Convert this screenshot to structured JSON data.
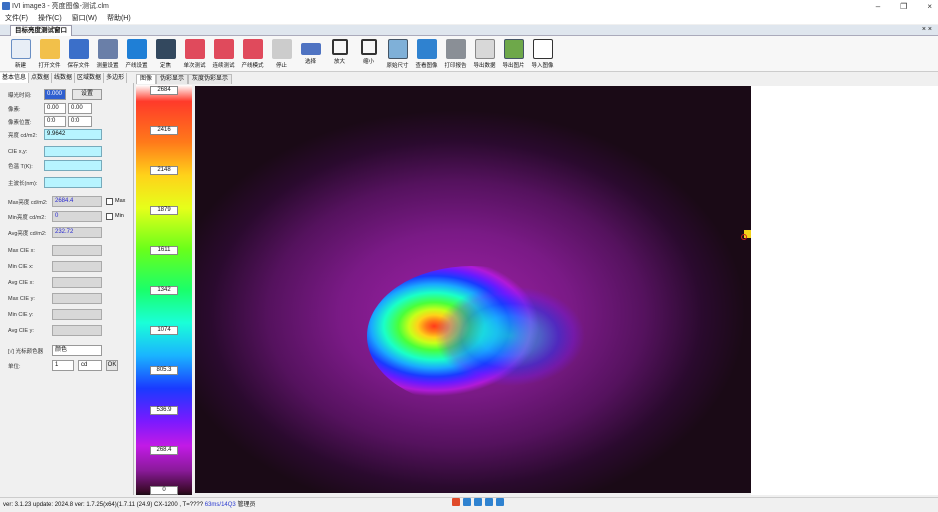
{
  "window": {
    "title": "IVI image3 - 亮度图像-测试.clm",
    "controls": [
      "–",
      "❐",
      "×"
    ]
  },
  "menu": [
    "文件(F)",
    "操作(C)",
    "窗口(W)",
    "帮助(H)"
  ],
  "mdi_tab": "目标亮度测试窗口",
  "mdi_close": "× ×",
  "toolbar": [
    {
      "label": "新建",
      "icon": "new-document-icon",
      "cls": "ic-new"
    },
    {
      "label": "打开文件",
      "icon": "folder-open-icon",
      "cls": "ic-open"
    },
    {
      "label": "保存文件",
      "icon": "save-disk-icon",
      "cls": "ic-save"
    },
    {
      "label": "测量设置",
      "icon": "gear-icon",
      "cls": "ic-gear"
    },
    {
      "label": "产线设置",
      "icon": "refresh-icon",
      "cls": "ic-blue"
    },
    {
      "label": "定焦",
      "icon": "camera-icon",
      "cls": "ic-dark"
    },
    {
      "label": "单次测试",
      "icon": "play-icon",
      "cls": "ic-play"
    },
    {
      "label": "连续测试",
      "icon": "play-icon",
      "cls": "ic-play"
    },
    {
      "label": "产线模式",
      "icon": "play-icon",
      "cls": "ic-play"
    },
    {
      "label": "停止",
      "icon": "stop-icon",
      "cls": "ic-stop"
    },
    {
      "label": "选择",
      "icon": "select-icon",
      "cls": "ic-sel"
    },
    {
      "label": "放大",
      "icon": "zoom-in-icon",
      "cls": "ic-zoom"
    },
    {
      "label": "缩小",
      "icon": "zoom-out-icon",
      "cls": "ic-zoom"
    },
    {
      "label": "原始尺寸",
      "icon": "image-icon",
      "cls": "ic-img"
    },
    {
      "label": "查看图像",
      "icon": "document-icon",
      "cls": "ic-doc"
    },
    {
      "label": "打印报告",
      "icon": "printer-icon",
      "cls": "ic-print"
    },
    {
      "label": "导出数据",
      "icon": "txt-file-icon",
      "cls": "ic-txt"
    },
    {
      "label": "导出图片",
      "icon": "picture-icon",
      "cls": "ic-pic"
    },
    {
      "label": "导入图像",
      "icon": "import-icon",
      "cls": "ic-exp"
    }
  ],
  "left_tabs": [
    "基本信息",
    "点数据",
    "线数据",
    "区域数据",
    "多边形"
  ],
  "left_panel": {
    "exposure_label": "曝光时间:",
    "exposure_value": "0.000",
    "exposure_btn": "设置",
    "pixel_label": "像素:",
    "pixel_a": "0.00",
    "pixel_b": "0.00",
    "pos_label": "像素位置:",
    "pos_a": "0:0",
    "pos_b": "0:0",
    "lum_label": "亮度 cd/m2:",
    "lum_value": "9.9642",
    "cie_label": "CIE x,y:",
    "cct_label": "色温 T(K):",
    "dom_label": "主波长(nm):",
    "max_lum_label": "Max亮度 cd/m2:",
    "max_lum_value": "2684.4",
    "max_chk": "Max",
    "min_lum_label": "Min亮度 cd/m2:",
    "min_lum_value": "0",
    "min_chk": "Min",
    "avg_lum_label": "Avg亮度 cd/m2:",
    "avg_lum_value": "232.72",
    "max_cie_x": "Max CIE x:",
    "min_cie_x": "Min CIE x:",
    "avg_cie_x": "Avg CIE x:",
    "max_cie_y": "Max CIE y:",
    "min_cie_y": "Min CIE y:",
    "avg_cie_y": "Avg CIE y:",
    "color_mode_label": "[√] 光标颜色器",
    "color_mode_value": "颜色",
    "unit_label": "单位:",
    "unit_value": "1",
    "unit_sel": "cd",
    "unit_btn": "OK"
  },
  "view_tabs": [
    "图像",
    "伪彩显示",
    "灰度伪彩显示"
  ],
  "colorbar": {
    "labels": [
      "2684",
      "2416",
      "2148",
      "1879",
      "1611",
      "1342",
      "1074",
      "805.3",
      "536.9",
      "268.4",
      "0"
    ]
  },
  "status": {
    "text": "ver: 3.1.23  update: 2024.8  ver: 1.7.25(x64)(1.7.11 (24.9)  CX-1200 ,  T=????",
    "link": "63ms/14Q3",
    "user": "管理员"
  }
}
